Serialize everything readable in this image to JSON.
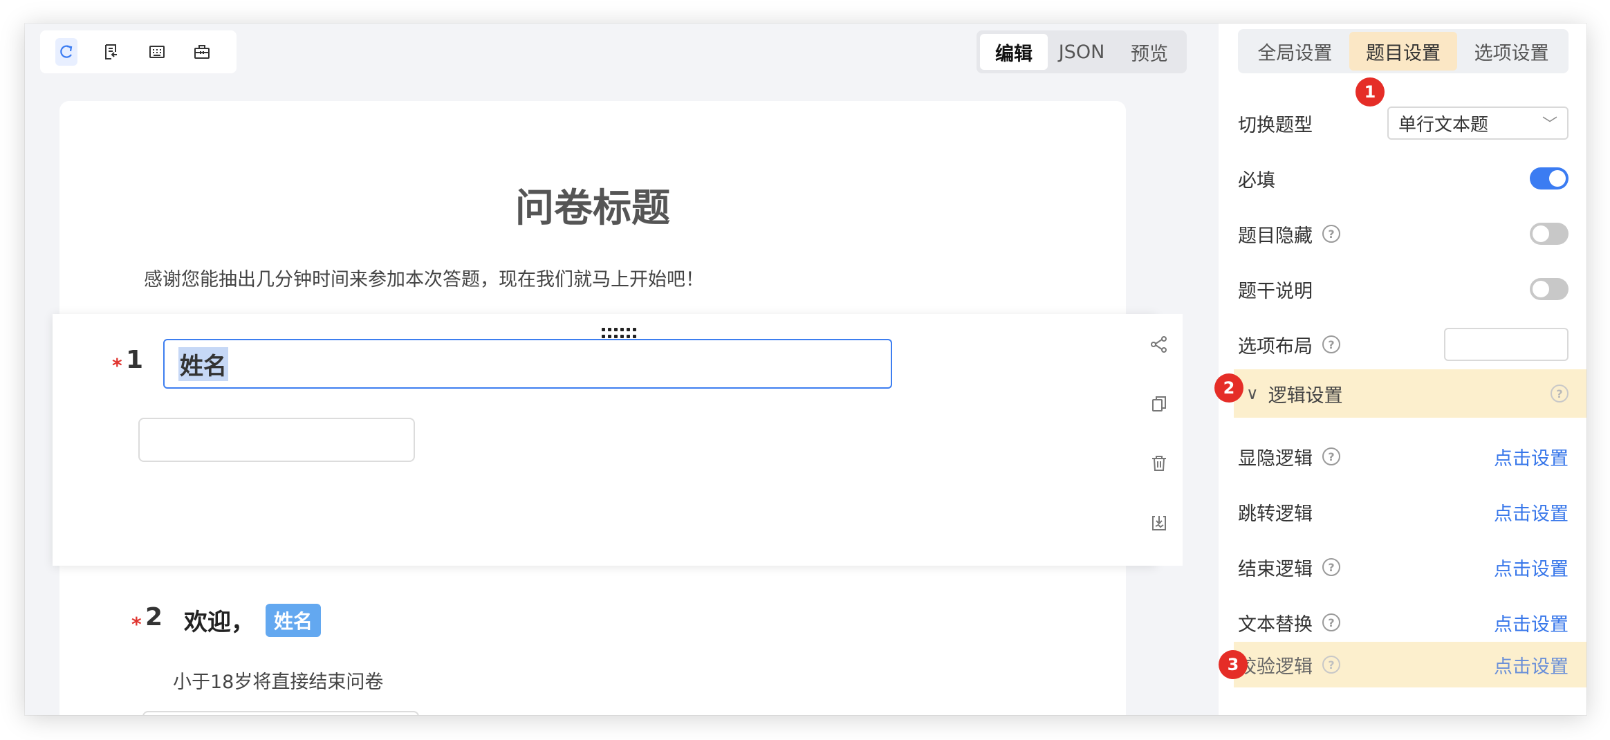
{
  "toolbar": {
    "tools": [
      "redo-icon",
      "import-icon",
      "keyboard-icon",
      "toolbox-icon"
    ]
  },
  "mode_tabs": [
    {
      "label": "编辑",
      "active": true
    },
    {
      "label": "JSON",
      "active": false
    },
    {
      "label": "预览",
      "active": false
    }
  ],
  "survey": {
    "title": "问卷标题",
    "description": "感谢您能抽出几分钟时间来参加本次答题，现在我们就马上开始吧！",
    "questions": [
      {
        "number": "1",
        "required": "*",
        "title": "姓名"
      },
      {
        "number": "2",
        "required": "*",
        "title": "欢迎，",
        "tag": "姓名",
        "description": "小于18岁将直接结束问卷"
      }
    ]
  },
  "side_actions": [
    "logic-icon",
    "copy-icon",
    "delete-icon",
    "save-template-icon"
  ],
  "panel": {
    "tabs": [
      {
        "label": "全局设置",
        "active": false
      },
      {
        "label": "题目设置",
        "active": true
      },
      {
        "label": "选项设置",
        "active": false
      }
    ],
    "switch_type": {
      "label": "切换题型",
      "value": "单行文本题"
    },
    "required": {
      "label": "必填",
      "on": true
    },
    "hidden": {
      "label": "题目隐藏",
      "on": false
    },
    "stem_desc": {
      "label": "题干说明",
      "on": false
    },
    "option_layout": {
      "label": "选项布局",
      "value": ""
    },
    "logic_section": {
      "label": "逻辑设置"
    },
    "show_hide_logic": {
      "label": "显隐逻辑",
      "action": "点击设置"
    },
    "jump_logic": {
      "label": "跳转逻辑",
      "action": "点击设置"
    },
    "end_logic": {
      "label": "结束逻辑",
      "action": "点击设置"
    },
    "text_replace": {
      "label": "文本替换",
      "action": "点击设置"
    },
    "validate_logic": {
      "label": "校验逻辑",
      "action": "点击设置"
    }
  },
  "badges": [
    "1",
    "2",
    "3"
  ],
  "colors": {
    "accent": "#3b7cf2",
    "highlight": "#fcefcd",
    "badge": "#e52d27",
    "required_star": "#e0342f",
    "tag": "#63a8f0"
  }
}
